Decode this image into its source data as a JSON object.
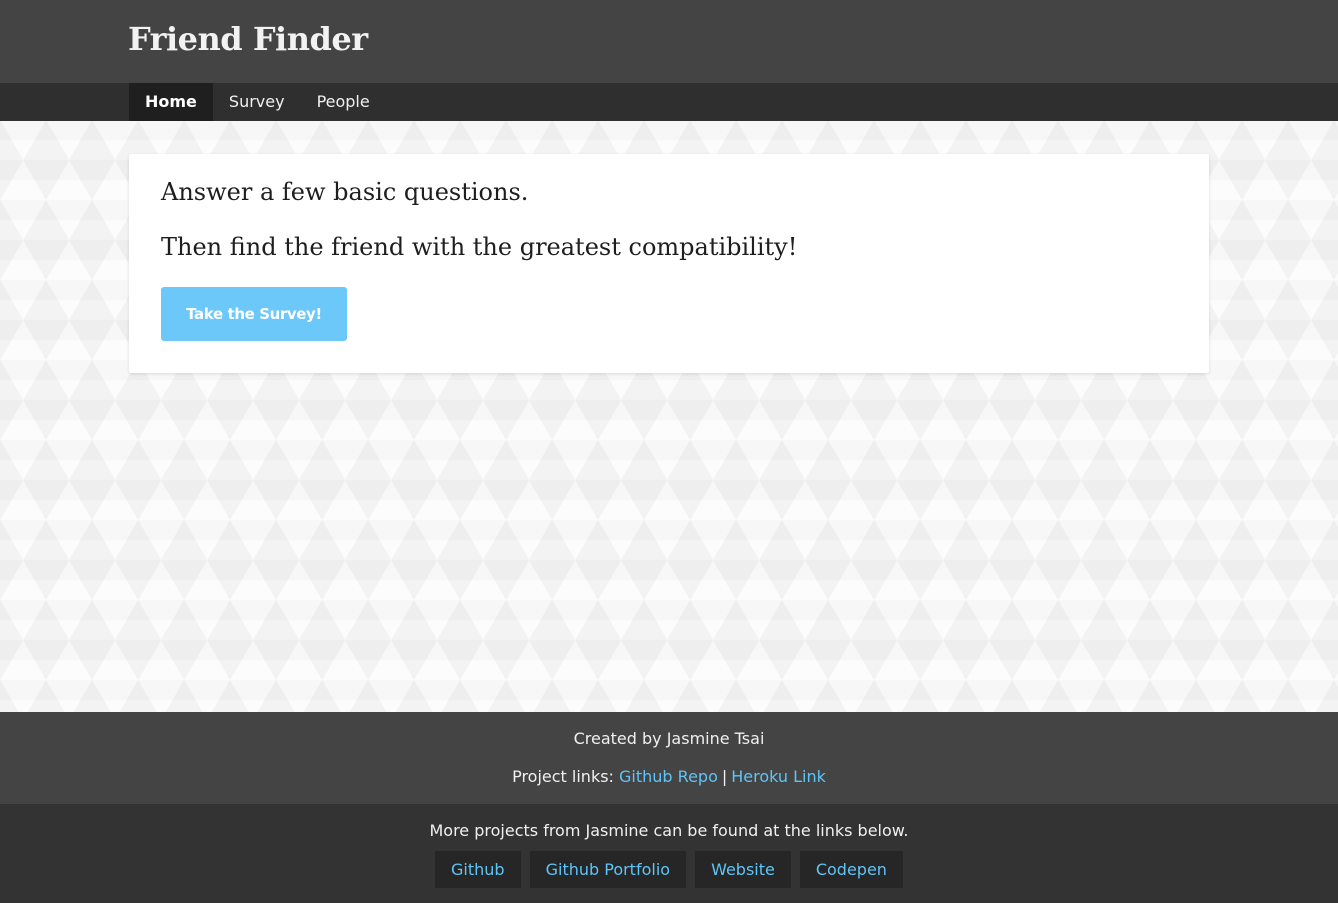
{
  "header": {
    "title": "Friend Finder"
  },
  "nav": {
    "items": [
      {
        "label": "Home",
        "active": true
      },
      {
        "label": "Survey",
        "active": false
      },
      {
        "label": "People",
        "active": false
      }
    ]
  },
  "main": {
    "line1": "Answer a few basic questions.",
    "line2": "Then find the friend with the greatest compatibility!",
    "cta_label": "Take the Survey!"
  },
  "footer": {
    "credit": "Created by Jasmine Tsai",
    "project_links_prefix": "Project links:",
    "project_links": [
      {
        "label": "Github Repo"
      },
      {
        "label": "Heroku Link"
      }
    ],
    "separator": "|",
    "more_text": "More projects from Jasmine can be found at the links below.",
    "external_links": [
      {
        "label": "Github"
      },
      {
        "label": "Github Portfolio"
      },
      {
        "label": "Website"
      },
      {
        "label": "Codepen"
      }
    ]
  },
  "colors": {
    "header_bg": "#444444",
    "nav_bg": "#2f2f2f",
    "accent": "#6cc8f8",
    "link": "#5fc4f7"
  }
}
